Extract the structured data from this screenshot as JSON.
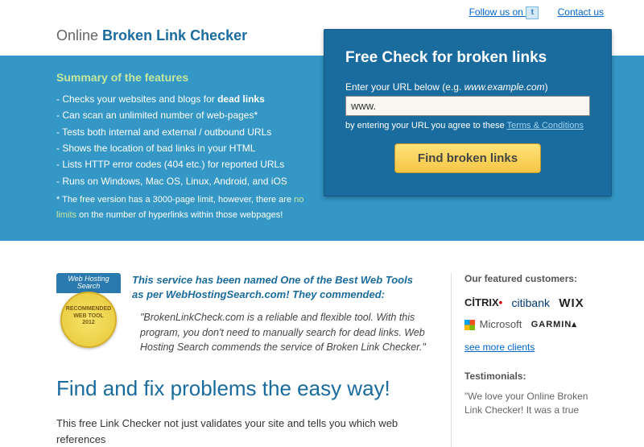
{
  "topLinks": {
    "follow": "Follow us on",
    "contact": "Contact us"
  },
  "title": {
    "prefix": "Online ",
    "main": "Broken Link Checker"
  },
  "features": {
    "title": "Summary of the features",
    "items": [
      "- Checks your websites and blogs for <b>dead links</b>",
      "- Can scan an unlimited number of web-pages*",
      "- Tests both internal and external / outbound URLs",
      "- Shows the location of bad links in your HTML",
      "- Lists HTTP error codes (404 etc.) for reported URLs",
      "- Runs on Windows, Mac OS, Linux, Android, and iOS"
    ],
    "footnote_pre": "*  The free version has a 3000-page limit, however, there are ",
    "footnote_accent": "no limits",
    "footnote_post": " on the number of hyperlinks within those webpages!"
  },
  "checkBox": {
    "heading": "Free Check for broken links",
    "label_pre": "Enter your URL below (e.g. ",
    "label_em": "www.example.com",
    "label_post": ")",
    "input_value": "www.",
    "terms_pre": "by entering your URL you agree to these ",
    "terms_link": "Terms & Conditions",
    "button": "Find broken links"
  },
  "commend": {
    "line": "This service has been named <b>One of the Best Web Tools as per WebHostingSearch.com! They commended:</b>",
    "quote": "\"BrokenLinkCheck.com is a reliable and flexible tool. With this program, you don't need to manually search for dead links. Web Hosting Search commends the service of Broken Link Checker.\""
  },
  "badge": {
    "ribbon": "Web Hosting Search",
    "seal_l1": "RECOMMENDED",
    "seal_l2": "WEB TOOL",
    "seal_l3": "2012"
  },
  "mainHeading": "Find and fix problems the easy way!",
  "bodyText": "This free Link Checker not just validates your site and tells you which web references",
  "side": {
    "featured": "Our featured customers:",
    "seeMore": "see more clients",
    "testimonialsTitle": "Testimonials:",
    "testimonial": "\"We love your Online Broken Link Checker! It was a true"
  },
  "logos": {
    "citrix": "CİTRIX",
    "citi": "citibank",
    "wix": "WIX",
    "microsoft": "Microsoft",
    "garmin": "GARMIN"
  }
}
